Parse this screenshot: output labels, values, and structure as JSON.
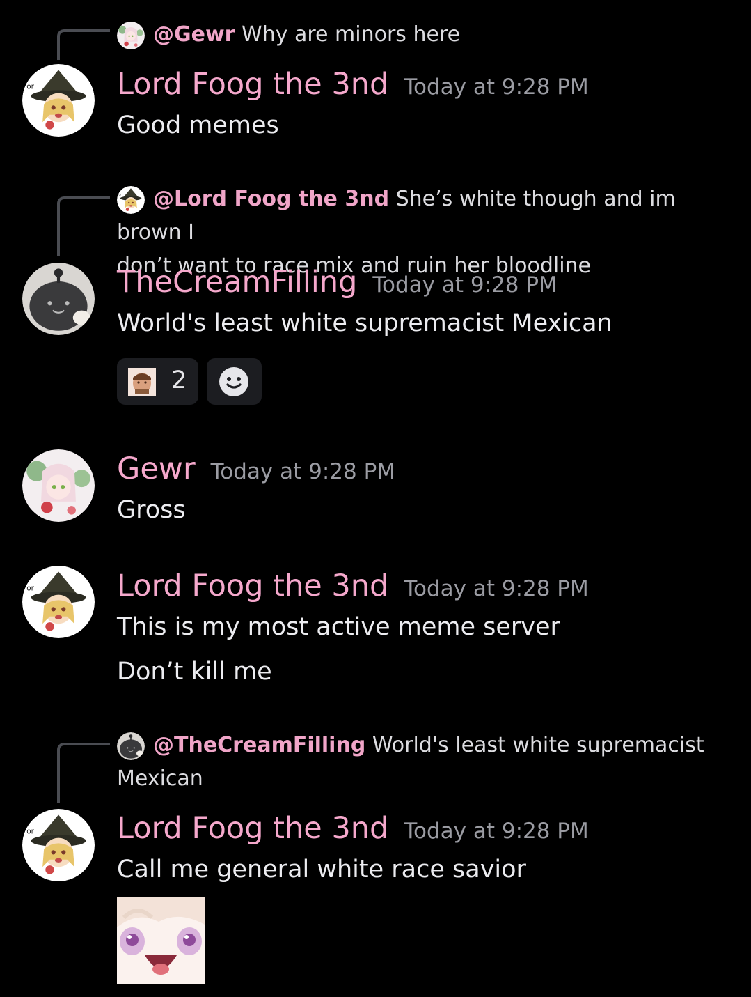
{
  "messages": [
    {
      "reply": {
        "mention": "@Gewr",
        "text": "Why are minors here"
      },
      "author": "Lord Foog the 3nd",
      "time": "Today at 9:28 PM",
      "lines": [
        "Good memes"
      ]
    },
    {
      "reply": {
        "mention": "@Lord Foog the 3nd",
        "text": "She’s white though and im brown I",
        "text2": "don’t want to race mix and ruin her bloodline"
      },
      "author": "TheCreamFilling",
      "time": "Today at 9:28 PM",
      "lines": [
        "World's least white supremacist Mexican"
      ],
      "reactions": [
        {
          "icon": "gigachad-emoji-icon",
          "count": "2"
        }
      ]
    },
    {
      "author": "Gewr",
      "time": "Today at 9:28 PM",
      "lines": [
        "Gross"
      ]
    },
    {
      "author": "Lord Foog the 3nd",
      "time": "Today at 9:28 PM",
      "lines": [
        "This is my most active meme server",
        "Don’t kill me"
      ]
    },
    {
      "reply": {
        "mention": "@TheCreamFilling",
        "text": "World's least white supremacist",
        "text2": "Mexican"
      },
      "author": "Lord Foog the 3nd",
      "time": "Today at 9:28 PM",
      "lines": [
        "Call me general white race savior"
      ],
      "attachment": "anime-face-sticker"
    }
  ],
  "colors": {
    "background": "#000000",
    "username": "#f5a8cc",
    "mention": "#f0a5c8",
    "timestamp": "#9b9ca3",
    "text": "#ececf0",
    "reaction_bg": "#1c1d21"
  }
}
